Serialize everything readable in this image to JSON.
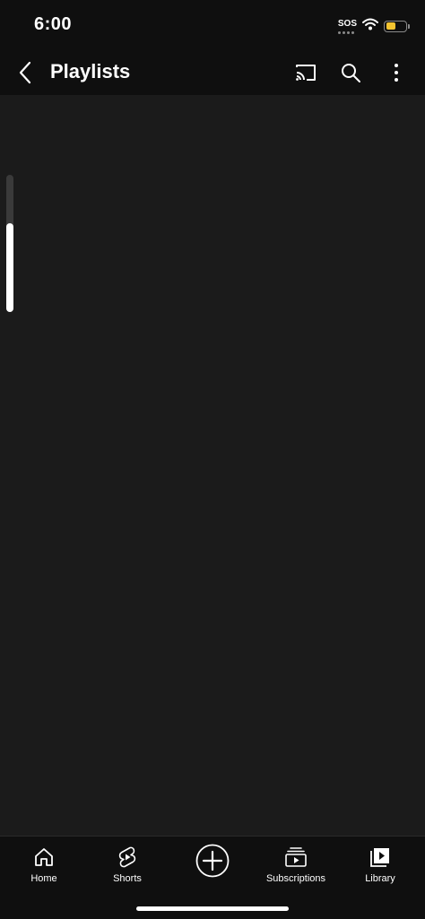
{
  "status_bar": {
    "time": "6:00",
    "sos_label": "SOS",
    "battery_level": 0.45,
    "battery_color": "#f4c430",
    "icons": [
      "wifi-icon",
      "battery-icon"
    ]
  },
  "header": {
    "title": "Playlists",
    "back_icon": "chevron-left-icon",
    "actions": [
      "cast-icon",
      "search-icon",
      "more-vertical-icon"
    ]
  },
  "content": {
    "scroll_position": 0.65,
    "background": "#1b1b1b"
  },
  "bottom_nav": {
    "items": [
      {
        "label": "Home",
        "icon": "home-icon"
      },
      {
        "label": "Shorts",
        "icon": "shorts-icon"
      },
      {
        "label": "",
        "icon": "create-plus-icon"
      },
      {
        "label": "Subscriptions",
        "icon": "subscriptions-icon"
      },
      {
        "label": "Library",
        "icon": "library-icon"
      }
    ]
  }
}
